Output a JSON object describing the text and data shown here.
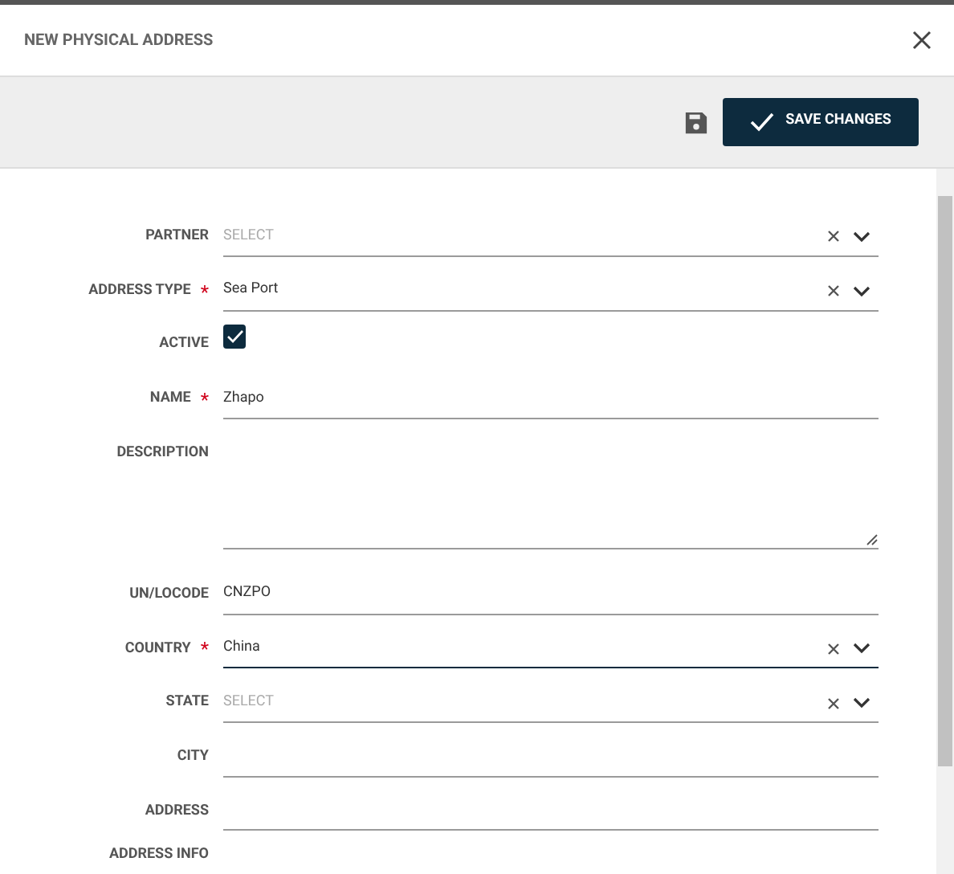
{
  "dialog": {
    "title": "NEW PHYSICAL ADDRESS"
  },
  "toolbar": {
    "save_button": "SAVE CHANGES"
  },
  "fields": [
    {
      "kind": "select",
      "label": "PARTNER",
      "placeholder": "SELECT",
      "focused": false
    },
    {
      "kind": "select",
      "label": "ADDRESS TYPE",
      "required_mark": "*",
      "value": "Sea Port",
      "focused": false
    },
    {
      "kind": "checkbox",
      "label": "ACTIVE",
      "checked": true
    },
    {
      "kind": "text",
      "label": "NAME",
      "required_mark": "*",
      "value": "Zhapo",
      "focused": false
    },
    {
      "kind": "textarea",
      "label": "DESCRIPTION",
      "focused": false
    },
    {
      "kind": "text",
      "label": "UN/LOCODE",
      "value": "CNZPO",
      "focused": false
    },
    {
      "kind": "select",
      "label": "COUNTRY",
      "required_mark": "*",
      "value": "China",
      "focused": true
    },
    {
      "kind": "select",
      "label": "STATE",
      "placeholder": "SELECT",
      "focused": false
    },
    {
      "kind": "text",
      "label": "CITY",
      "focused": false
    },
    {
      "kind": "text",
      "label": "ADDRESS",
      "focused": false
    },
    {
      "kind": "label",
      "label": "ADDRESS INFO"
    }
  ]
}
